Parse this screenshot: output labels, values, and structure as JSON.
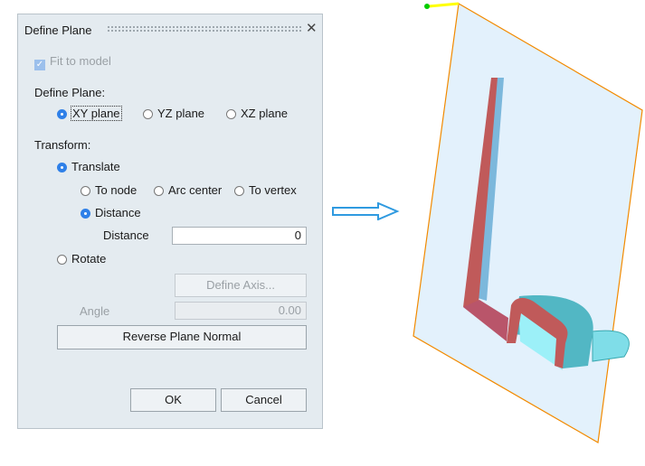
{
  "dialog": {
    "title": "Define Plane",
    "fit_to_model": "Fit to model",
    "define_plane_label": "Define Plane:",
    "planes": [
      "XY plane",
      "YZ plane",
      "XZ plane"
    ],
    "selected_plane": "XY plane",
    "transform_label": "Transform:",
    "translate": "Translate",
    "to_node": "To node",
    "arc_center": "Arc center",
    "to_vertex": "To vertex",
    "distance_option": "Distance",
    "distance_label": "Distance",
    "distance_value": "0",
    "rotate": "Rotate",
    "define_axis": "Define Axis...",
    "angle_label": "Angle",
    "angle_value": "0.00",
    "reverse": "Reverse Plane Normal",
    "ok": "OK",
    "cancel": "Cancel"
  },
  "colors": {
    "plane_fill": "#e3f1fc",
    "plane_edge": "#f28a00",
    "section": "#c05a5a",
    "part": "#7fdde8"
  }
}
